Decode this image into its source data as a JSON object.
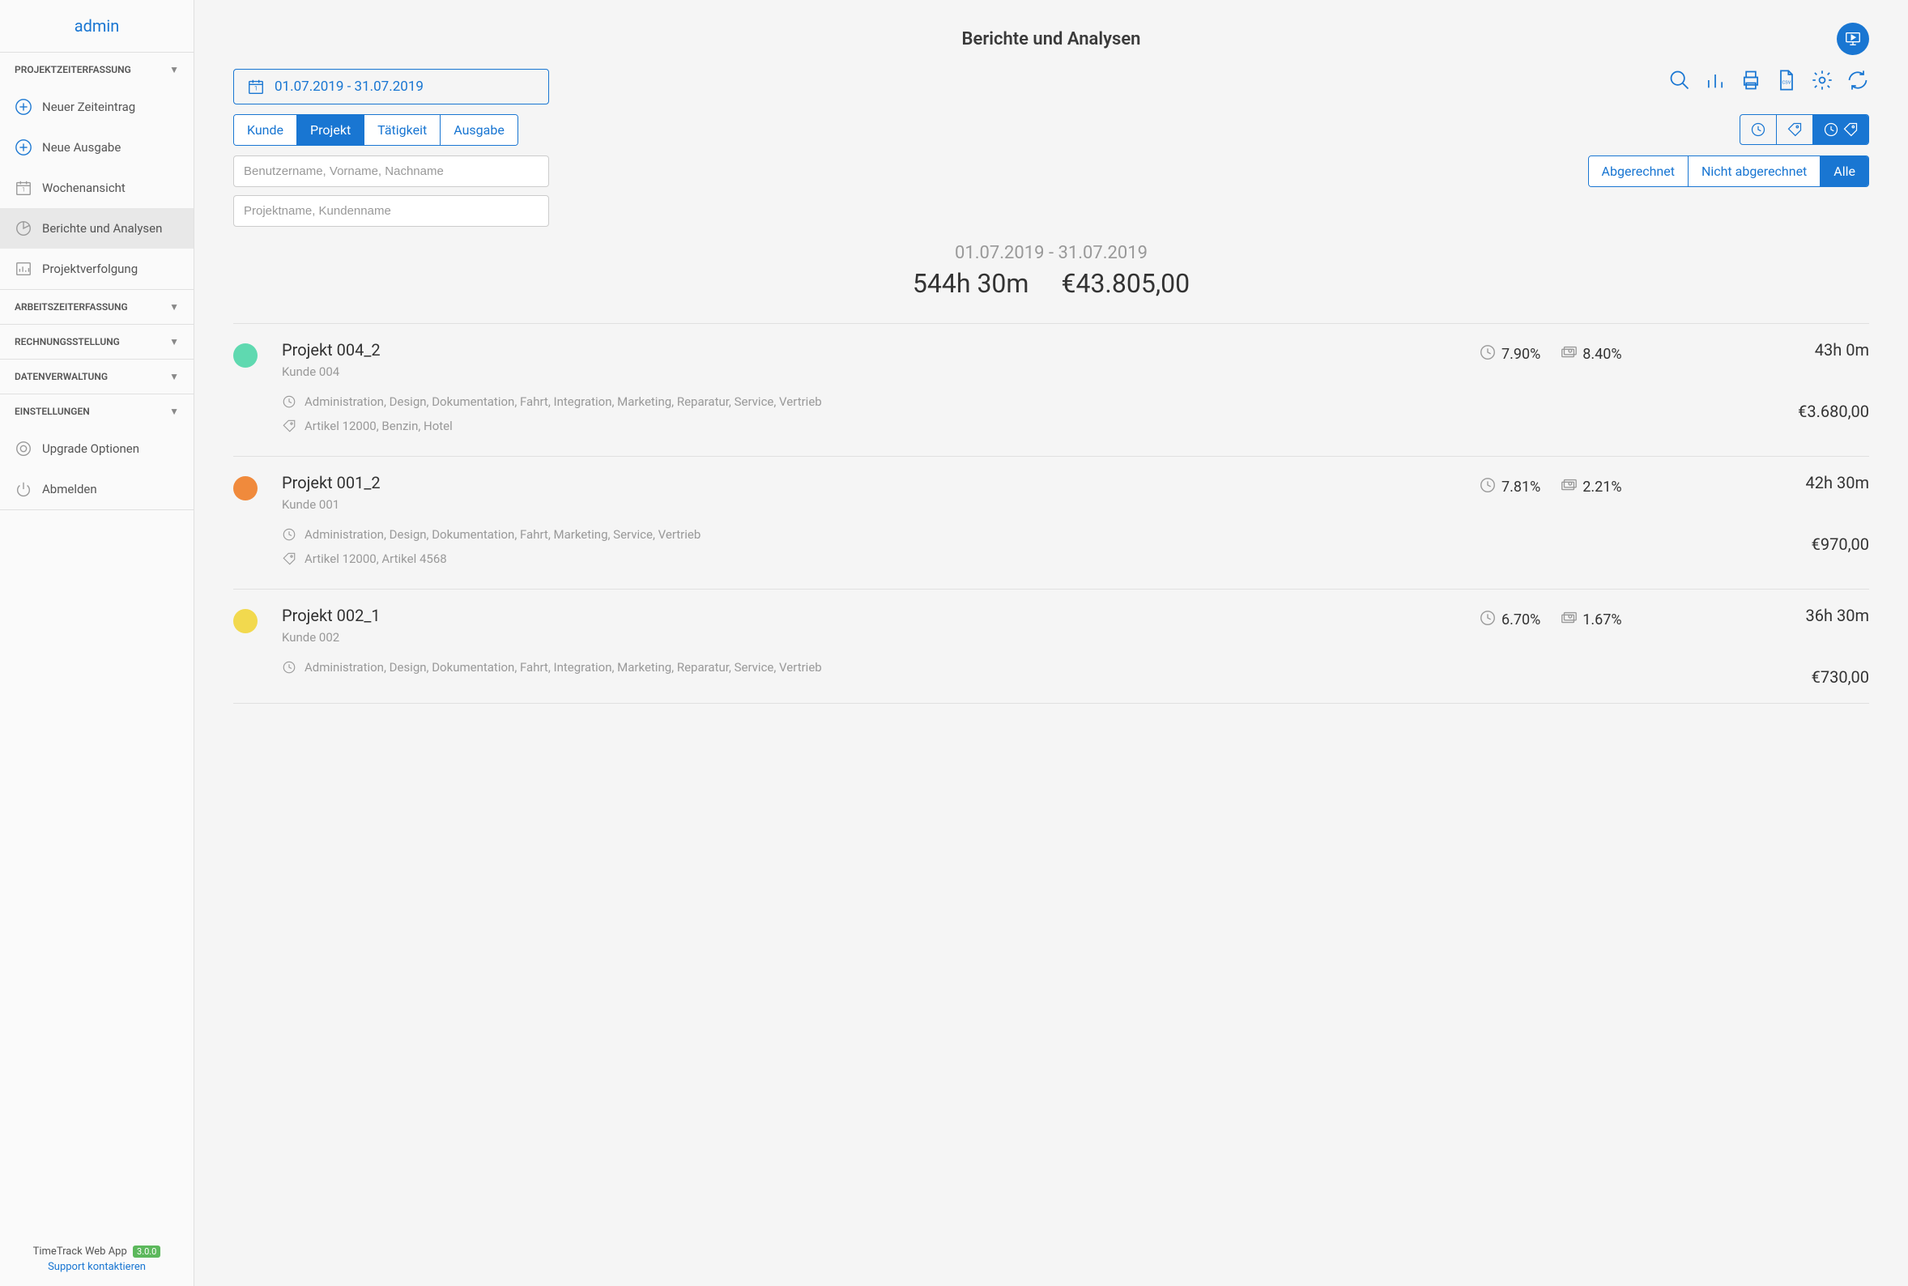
{
  "sidebar": {
    "user": "admin",
    "sections": {
      "projektzeit": {
        "title": "PROJEKTZEITERFASSUNG",
        "items": [
          {
            "label": "Neuer Zeiteintrag"
          },
          {
            "label": "Neue Ausgabe"
          },
          {
            "label": "Wochenansicht"
          },
          {
            "label": "Berichte und Analysen"
          },
          {
            "label": "Projektverfolgung"
          }
        ]
      },
      "arbeitszeit": {
        "title": "ARBEITSZEITERFASSUNG"
      },
      "rechnung": {
        "title": "RECHNUNGSSTELLUNG"
      },
      "daten": {
        "title": "DATENVERWALTUNG"
      },
      "einstellungen": {
        "title": "EINSTELLUNGEN",
        "items": [
          {
            "label": "Upgrade Optionen"
          },
          {
            "label": "Abmelden"
          }
        ]
      }
    },
    "footer": {
      "app_name": "TimeTrack Web App",
      "version": "3.0.0",
      "support": "Support kontaktieren"
    }
  },
  "header": {
    "title": "Berichte und Analysen"
  },
  "filters": {
    "date_range": "01.07.2019 - 31.07.2019",
    "group_by": {
      "options": [
        "Kunde",
        "Projekt",
        "Tätigkeit",
        "Ausgabe"
      ],
      "active": "Projekt"
    },
    "user_placeholder": "Benutzername, Vorname, Nachname",
    "project_placeholder": "Projektname, Kundenname",
    "billing": {
      "options": [
        "Abgerechnet",
        "Nicht abgerechnet",
        "Alle"
      ],
      "active": "Alle"
    }
  },
  "summary": {
    "range": "01.07.2019 - 31.07.2019",
    "hours": "544h 30m",
    "amount": "€43.805,00"
  },
  "projects": [
    {
      "color": "#5fd9b0",
      "name": "Projekt 004_2",
      "client": "Kunde 004",
      "time_pct": "7.90%",
      "cost_pct": "8.40%",
      "hours": "43h 0m",
      "amount": "€3.680,00",
      "activities": "Administration, Design, Dokumentation, Fahrt, Integration, Marketing, Reparatur, Service, Vertrieb",
      "expenses": "Artikel 12000, Benzin, Hotel"
    },
    {
      "color": "#f08a3c",
      "name": "Projekt 001_2",
      "client": "Kunde 001",
      "time_pct": "7.81%",
      "cost_pct": "2.21%",
      "hours": "42h 30m",
      "amount": "€970,00",
      "activities": "Administration, Design, Dokumentation, Fahrt, Marketing, Service, Vertrieb",
      "expenses": "Artikel 12000, Artikel 4568"
    },
    {
      "color": "#f2d94e",
      "name": "Projekt 002_1",
      "client": "Kunde 002",
      "time_pct": "6.70%",
      "cost_pct": "1.67%",
      "hours": "36h 30m",
      "amount": "€730,00",
      "activities": "Administration, Design, Dokumentation, Fahrt, Integration, Marketing, Reparatur, Service, Vertrieb",
      "expenses": ""
    }
  ]
}
